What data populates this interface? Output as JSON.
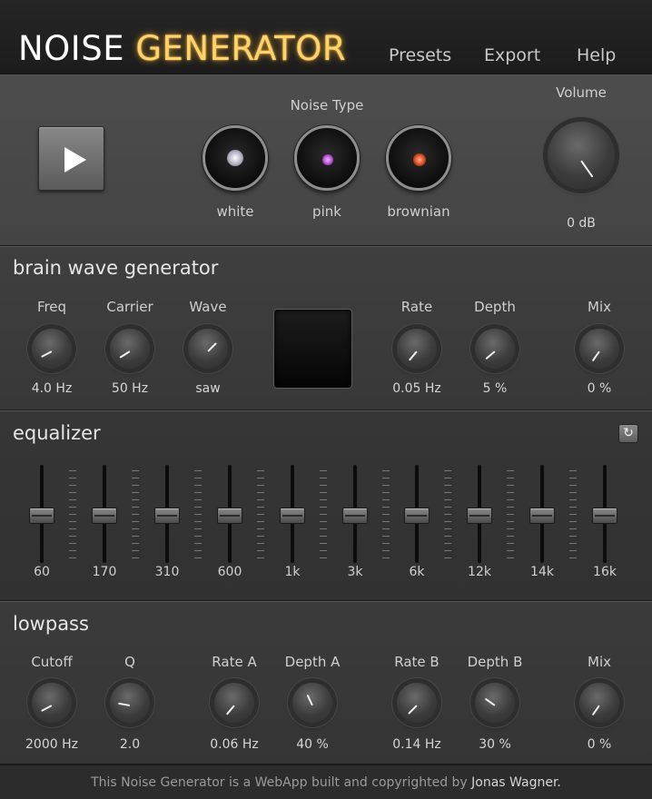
{
  "header": {
    "logo_part1": "NOISE",
    "logo_part2": "GENERATOR",
    "nav": [
      "Presets",
      "Export",
      "Help"
    ]
  },
  "noise": {
    "section_label": "Noise Type",
    "types": [
      {
        "label": "white",
        "color": "#d8d8e8"
      },
      {
        "label": "pink",
        "color": "#c85ad8"
      },
      {
        "label": "brownian",
        "color": "#d84a2a"
      }
    ],
    "volume_label": "Volume",
    "volume_value": "0 dB"
  },
  "brainwave": {
    "title": "brain wave generator",
    "knobs": [
      {
        "label": "Freq",
        "value": "4.0 Hz"
      },
      {
        "label": "Carrier",
        "value": "50 Hz"
      },
      {
        "label": "Wave",
        "value": "saw"
      },
      {
        "label": "Rate",
        "value": "0.05 Hz"
      },
      {
        "label": "Depth",
        "value": "5 %"
      },
      {
        "label": "Mix",
        "value": "0 %"
      }
    ]
  },
  "equalizer": {
    "title": "equalizer",
    "reset_icon": "reset-icon",
    "bands": [
      "60",
      "170",
      "310",
      "600",
      "1k",
      "3k",
      "6k",
      "12k",
      "14k",
      "16k"
    ],
    "gain_fraction": [
      0.5,
      0.5,
      0.5,
      0.5,
      0.5,
      0.5,
      0.5,
      0.5,
      0.5,
      0.5
    ]
  },
  "lowpass": {
    "title": "lowpass",
    "knobs": [
      {
        "label": "Cutoff",
        "value": "2000 Hz"
      },
      {
        "label": "Q",
        "value": "2.0"
      },
      {
        "label": "Rate A",
        "value": "0.06 Hz"
      },
      {
        "label": "Depth A",
        "value": "40 %"
      },
      {
        "label": "Rate B",
        "value": "0.14 Hz"
      },
      {
        "label": "Depth B",
        "value": "30 %"
      },
      {
        "label": "Mix",
        "value": "0 %"
      }
    ]
  },
  "footer": {
    "text": "This Noise Generator is a WebApp built and copyrighted by",
    "author": "Jonas Wagner."
  },
  "colors": {
    "accent": "#ffd36a",
    "background": "#2a2a2a"
  }
}
